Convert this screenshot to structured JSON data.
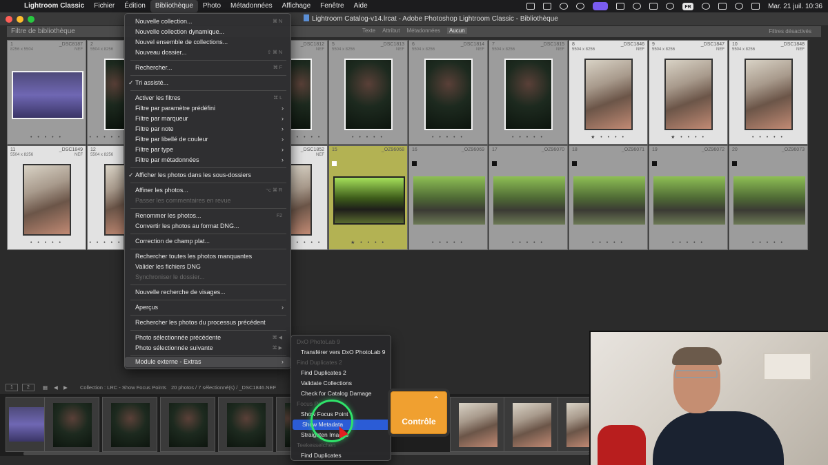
{
  "menubar": {
    "app": "Lightroom Classic",
    "items": [
      "Fichier",
      "Édition",
      "Bibliothèque",
      "Photo",
      "Métadonnées",
      "Affichage",
      "Fenêtre",
      "Aide"
    ],
    "clock": "Mar. 21 juil.  10:36",
    "lang": "FR"
  },
  "window": {
    "title": "Lightroom Catalog-v14.lrcat - Adobe Photoshop Lightroom Classic - Bibliothèque"
  },
  "filter": {
    "label": "Filtre de bibliothèque",
    "options": [
      "Texte",
      "Attribut",
      "Métadonnées",
      "Aucun"
    ],
    "active": "Aucun",
    "status": "Filtres désactivés"
  },
  "grid": {
    "row1": [
      {
        "n": "1",
        "name": "_DSC8187",
        "dim": "8256 x 5504",
        "fmt": "NEF",
        "stars": "• • • • •"
      },
      {
        "n": "2",
        "name": "",
        "dim": "5504 x 8256",
        "fmt": "",
        "stars": "• • • • •"
      },
      {
        "n": "",
        "name": "_DSC1812",
        "dim": "",
        "fmt": "NEF",
        "stars": "• • • •"
      },
      {
        "n": "5",
        "name": "_DSC1813",
        "dim": "5504 x 8256",
        "fmt": "NEF",
        "stars": "• • • • •"
      },
      {
        "n": "6",
        "name": "_DSC1814",
        "dim": "5504 x 8256",
        "fmt": "NEF",
        "stars": "• • • • •"
      },
      {
        "n": "7",
        "name": "_DSC1815",
        "dim": "5504 x 8256",
        "fmt": "NEF",
        "stars": "• • • • •"
      },
      {
        "n": "8",
        "name": "_DSC1846",
        "dim": "5504 x 8256",
        "fmt": "NEF",
        "stars": "★ • • • •"
      },
      {
        "n": "9",
        "name": "_DSC1847",
        "dim": "5504 x 8256",
        "fmt": "NEF",
        "stars": "★ • • • •"
      },
      {
        "n": "10",
        "name": "_DSC1848",
        "dim": "5504 x 8256",
        "fmt": "NEF",
        "stars": "• • • • •"
      }
    ],
    "row2": [
      {
        "n": "11",
        "name": "_DSC1849",
        "dim": "5504 x 8256",
        "fmt": "NEF",
        "stars": "• • • • •"
      },
      {
        "n": "12",
        "name": "",
        "dim": "5504 x 8256",
        "fmt": "",
        "stars": "• • • • •"
      },
      {
        "n": "",
        "name": "_DSC1852",
        "dim": "",
        "fmt": "NEF",
        "stars": "• • • •"
      },
      {
        "n": "15",
        "name": "_OZ96068",
        "dim": "",
        "fmt": "",
        "stars": "★ • • • •"
      },
      {
        "n": "16",
        "name": "_OZ96069",
        "dim": "",
        "fmt": "",
        "stars": "• • • • •"
      },
      {
        "n": "17",
        "name": "_OZ96070",
        "dim": "",
        "fmt": "",
        "stars": "• • • • •"
      },
      {
        "n": "18",
        "name": "_OZ96071",
        "dim": "",
        "fmt": "",
        "stars": "• • • • •"
      },
      {
        "n": "19",
        "name": "_OZ96072",
        "dim": "",
        "fmt": "",
        "stars": "• • • • •"
      },
      {
        "n": "20",
        "name": "_OZ96073",
        "dim": "",
        "fmt": "",
        "stars": "• • • • •"
      }
    ]
  },
  "menu": {
    "items": [
      {
        "label": "Nouvelle collection...",
        "sc": "⌘ N"
      },
      {
        "label": "Nouvelle collection dynamique...",
        "sc": ""
      },
      {
        "label": "Nouvel ensemble de collections...",
        "sc": ""
      },
      {
        "label": "Nouveau dossier...",
        "sc": "⇧ ⌘ N"
      },
      {
        "label": "Rechercher...",
        "sc": "⌘ F"
      },
      {
        "label": "Tri assisté...",
        "sc": ""
      },
      {
        "label": "Activer les filtres",
        "sc": "⌘ L"
      },
      {
        "label": "Filtre par paramètre prédéfini",
        "sc": ""
      },
      {
        "label": "Filtre par marqueur",
        "sc": ""
      },
      {
        "label": "Filtre par note",
        "sc": ""
      },
      {
        "label": "Filtre par libellé de couleur",
        "sc": ""
      },
      {
        "label": "Filtre par type",
        "sc": ""
      },
      {
        "label": "Filtre par métadonnées",
        "sc": ""
      },
      {
        "label": "Afficher les photos dans les sous-dossiers",
        "sc": ""
      },
      {
        "label": "Affiner les photos...",
        "sc": "⌥ ⌘ R"
      },
      {
        "label": "Passer les commentaires en revue",
        "sc": ""
      },
      {
        "label": "Renommer les photos...",
        "sc": "F2"
      },
      {
        "label": "Convertir les photos au format DNG...",
        "sc": ""
      },
      {
        "label": "Correction de champ plat...",
        "sc": ""
      },
      {
        "label": "Rechercher toutes les photos manquantes",
        "sc": ""
      },
      {
        "label": "Valider les fichiers DNG",
        "sc": ""
      },
      {
        "label": "Synchroniser le dossier...",
        "sc": ""
      },
      {
        "label": "Nouvelle recherche de visages...",
        "sc": ""
      },
      {
        "label": "Aperçus",
        "sc": ""
      },
      {
        "label": "Rechercher les photos du processus précédent",
        "sc": ""
      },
      {
        "label": "Photo sélectionnée précédente",
        "sc": "⌘ ◀"
      },
      {
        "label": "Photo sélectionnée suivante",
        "sc": "⌘ ▶"
      },
      {
        "label": "Module externe - Extras",
        "sc": ""
      }
    ]
  },
  "submenu": {
    "items": [
      "DxO PhotoLab 9",
      "Transférer vers DxO PhotoLab 9",
      "Find Duplicates 2",
      "Find Duplicates 2",
      "Validate Collections",
      "Check for Catalog Damage",
      "Focus Po",
      "Show Focus Point",
      "Show Metadata",
      "Straighten Images",
      "Teekesselchen",
      "Find Duplicates"
    ]
  },
  "controle": {
    "label": "Contrôle"
  },
  "filmstrip": {
    "collection": "Collection : LRC - Show Focus Points",
    "count": "20 photos / 7 sélectionné(s) / _DSC1846.NEF",
    "pages": [
      "1",
      "2"
    ]
  }
}
